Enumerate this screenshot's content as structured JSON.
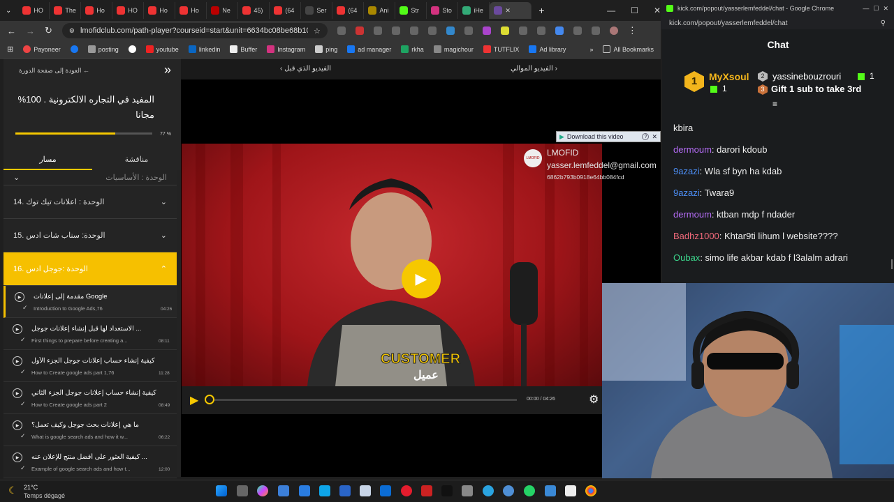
{
  "tabs": [
    "HO",
    "The",
    "Ho",
    "HO",
    "Ho",
    "Ho",
    "Ne",
    "45)",
    "(64",
    "Ser",
    "(64",
    "Ani",
    "Str",
    "Sto",
    "iHe"
  ],
  "address": {
    "url": "lmofidclub.com/path-player?courseid=start&unit=6634bc08be68b10b770a..."
  },
  "bookmarks": [
    "Payoneer",
    "posting",
    "youtube",
    "linkedin",
    "Buffer",
    "Instagram",
    "ping",
    "ad manager",
    "rkha",
    "magichour",
    "TUTFLIX",
    "Ad library",
    "All Bookmarks"
  ],
  "sidebar": {
    "back_link": "العودة إلى صفحة الدورة",
    "course_title": "المفيد في التجاره الالكترونية . 100% مجانا",
    "progress_pct": "77 %",
    "progress_value": 0.73,
    "tab_path": "مسار",
    "tab_discussion": "مناقشة",
    "cut_unit": "الوحدة : الأساسيات",
    "units": [
      {
        "label": "الوحدة : اعلانات تيك توك .14"
      },
      {
        "label": "الوحدة: سناب شات ادس .15"
      },
      {
        "label": "الوحدة :جوجل ادس .16"
      }
    ],
    "lessons": [
      {
        "ar": "مقدمة إلى إعلانات Google",
        "en": "Introduction to Google Ads,76",
        "dur": "04:26"
      },
      {
        "ar": "الاستعداد لها قبل إنشاء إعلانات جوجل ...",
        "en": "First things to prepare before creating a...",
        "dur": "08:11"
      },
      {
        "ar": "كيفية إنشاء حساب إعلانات جوجل الجزء الأول ...",
        "en": "How to Create google ads part 1,76",
        "dur": "11:28"
      },
      {
        "ar": "كيفية إنشاء حساب إعلانات جوجل الجزء الثاني ...",
        "en": "How to Create google ads part 2",
        "dur": "08:49"
      },
      {
        "ar": "ما هي إعلانات بحث جوجل وكيف تعمل؟",
        "en": "What is google search ads and how it w...",
        "dur": "06:22"
      },
      {
        "ar": "كيفية العثور على أفضل منتج للإعلان عنه ...",
        "en": "Example of google search ads and how t...",
        "dur": "12:00"
      }
    ]
  },
  "nav": {
    "prev": "الفيديو الذي قبل",
    "next": "الفيديو الموالي"
  },
  "video": {
    "download_label": "Download this video",
    "wm_name": "LMOFID",
    "wm_email": "yasser.lemfeddel@gmail.com",
    "wm_id": "6862b793b0918e64bb084fcd",
    "caption_en": "CUSTOMER",
    "caption_ar": "عميل",
    "time": "00:00 / 04:26",
    "played_fraction": 0.0
  },
  "kick": {
    "window_title": "kick.com/popout/yasserlemfeddel/chat - Google Chrome",
    "url": "kick.com/popout/yasserlemfeddel/chat",
    "chat_title": "Chat",
    "leader1_name": "MyXsoul",
    "leader1_count": "1",
    "leader2_name": "yassinebouzrouri",
    "leader2_count": "1",
    "gift_text": "Gift 1 sub to take 3rd",
    "messages": [
      {
        "user": "",
        "text": "kbira",
        "color": "#ffffff"
      },
      {
        "user": "dermoum",
        "text": "darori kdoub",
        "color": "#b46cf5"
      },
      {
        "user": "9azazi",
        "text": "Wla sf byn ha kdab",
        "color": "#4c8ef5"
      },
      {
        "user": "9azazi",
        "text": "Twara9",
        "color": "#4c8ef5"
      },
      {
        "user": "dermoum",
        "text": "ktban mdp f ndader",
        "color": "#b46cf5"
      },
      {
        "user": "Badhz1000",
        "text": "Khtar9ti lihum l website????",
        "color": "#f0697a"
      },
      {
        "user": "Oubax",
        "text": "simo life akbar kdab f l3alalm adrari",
        "color": "#3cd68c"
      }
    ]
  },
  "taskbar": {
    "temp": "21°C",
    "weather": "Temps dégagé"
  },
  "colors": {
    "accent": "#f6c800",
    "kick_green": "#53fc18"
  }
}
